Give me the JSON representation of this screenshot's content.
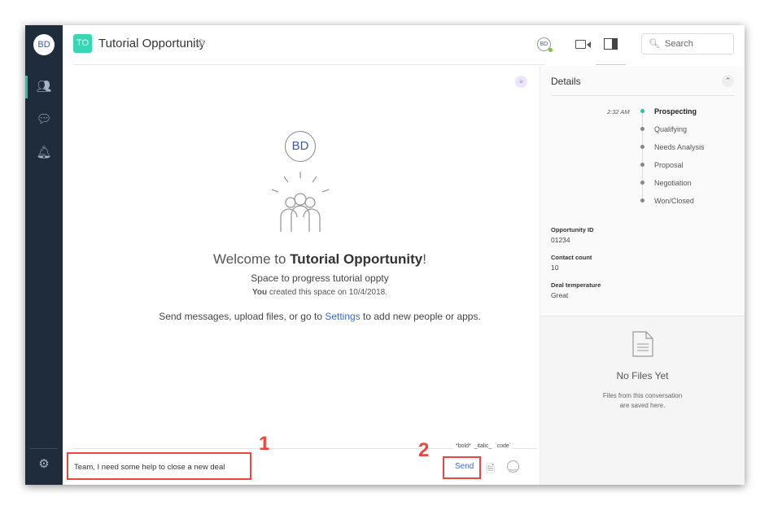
{
  "sidebar": {
    "avatar": "BD"
  },
  "header": {
    "space_badge": "TO",
    "title": "Tutorial Opportunity",
    "presence_avatar": "BD",
    "search_placeholder": "Search"
  },
  "welcome": {
    "avatar": "BD",
    "heading_prefix": "Welcome to ",
    "heading_name": "Tutorial Opportunity",
    "heading_suffix": "!",
    "subtitle": "Space to progress tutorial oppty",
    "created_you": "You",
    "created_rest": " created this space on 10/4/2018.",
    "hint_prefix": "Send messages, upload files, or go to ",
    "hint_link": "Settings",
    "hint_suffix": " to add new people or apps."
  },
  "details": {
    "title": "Details",
    "time": "2:32 AM",
    "stages": [
      "Prospecting",
      "Qualifying",
      "Needs Analysis",
      "Proposal",
      "Negotiation",
      "Won/Closed"
    ],
    "current_stage": "Prospecting",
    "fields": [
      {
        "label": "Opportunity ID",
        "value": "01234"
      },
      {
        "label": "Contact count",
        "value": "10"
      },
      {
        "label": "Deal temperature",
        "value": "Great"
      }
    ]
  },
  "files": {
    "title": "No Files Yet",
    "subtitle_1": "Files from this conversation",
    "subtitle_2": "are saved here."
  },
  "composer": {
    "message": "Team, I need some help to close a new deal",
    "send": "Send",
    "fmt_bold": "*bold*",
    "fmt_italic": "_italic_",
    "fmt_code": "`code`"
  },
  "annotations": {
    "step1": "1",
    "step2": "2"
  },
  "colors": {
    "accent": "#1bc7a2",
    "sidebar": "#1e2c3c",
    "link": "#3d6bc4",
    "highlight": "#e9473f"
  }
}
